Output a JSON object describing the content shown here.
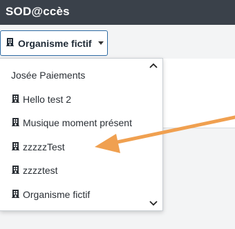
{
  "app": {
    "title": "SOD@ccès"
  },
  "org_button": {
    "label": "Organisme fictif",
    "icon": "building-icon"
  },
  "dropdown": {
    "items": [
      {
        "label": "Josée Paiements",
        "icon": null
      },
      {
        "label": "Hello test 2",
        "icon": "building-icon"
      },
      {
        "label": "Musique moment présent",
        "icon": "building-icon"
      },
      {
        "label": "zzzzzTest",
        "icon": "building-icon"
      },
      {
        "label": "zzzztest",
        "icon": "building-icon"
      },
      {
        "label": "Organisme fictif",
        "icon": "building-icon"
      }
    ]
  },
  "colors": {
    "topbar": "#3a414a",
    "button_border": "#2d6aa3",
    "annotation_arrow": "#f0a050"
  }
}
